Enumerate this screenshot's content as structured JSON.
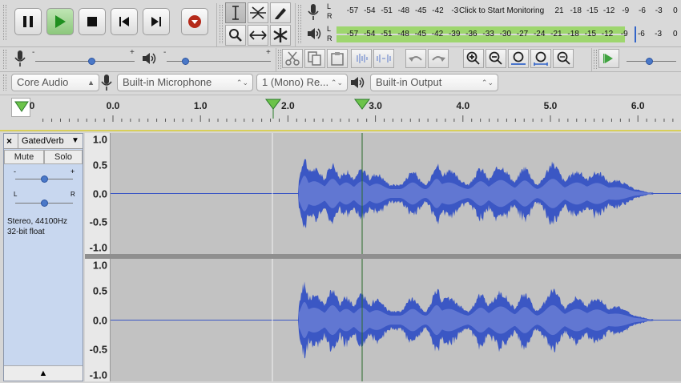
{
  "transport": {
    "buttons": [
      {
        "name": "pause",
        "label": "Pause"
      },
      {
        "name": "play",
        "label": "Play"
      },
      {
        "name": "stop",
        "label": "Stop"
      },
      {
        "name": "skip-to-start",
        "label": "Skip to Start"
      },
      {
        "name": "skip-to-end",
        "label": "Skip to End"
      },
      {
        "name": "record",
        "label": "Record"
      }
    ]
  },
  "tools": [
    "selection-tool",
    "envelope-tool",
    "draw-tool",
    "zoom-tool",
    "time-shift-tool",
    "multi-tool"
  ],
  "meters": {
    "record_scale": [
      "-57",
      "-54",
      "-51",
      "-48",
      "-45",
      "-42",
      "-3"
    ],
    "record_prompt": "Click to Start Monitoring",
    "record_scale_right": [
      "21",
      "-18",
      "-15",
      "-12",
      "-9",
      "-6",
      "-3",
      "0"
    ],
    "play_scale": [
      "-57",
      "-54",
      "-51",
      "-48",
      "-45",
      "-42",
      "-39",
      "-36",
      "-33",
      "-30",
      "-27",
      "-24",
      "-21",
      "-18",
      "-15",
      "-12",
      "-9",
      "-6",
      "-3",
      "0"
    ],
    "l_label": "L",
    "r_label": "R",
    "play_level_fraction": 0.83
  },
  "mixer": {
    "record_volume_fraction": 0.42,
    "playback_volume_fraction": 0.18,
    "slider_minus": "-",
    "slider_plus": "+"
  },
  "devices": {
    "host": "Core Audio",
    "recording_device": "Built-in Microphone",
    "channels": "1 (Mono) Re...",
    "playback_device": "Built-in Output"
  },
  "timeline": {
    "labels": [
      "0",
      "0.0",
      "1.0",
      "2.0",
      "3.0",
      "4.0",
      "5.0",
      "6.0"
    ],
    "cursor_seconds": 2.0,
    "play_head_seconds": 3.02
  },
  "track": {
    "name": "GatedVerb",
    "close_label": "×",
    "menu_arrow": "▼",
    "mute_label": "Mute",
    "solo_label": "Solo",
    "gain_minus": "-",
    "gain_plus": "+",
    "pan_left": "L",
    "pan_right": "R",
    "info_line1": "Stereo, 44100Hz",
    "info_line2": "32-bit float",
    "collapse_arrow": "▲",
    "scale_labels": [
      "1.0",
      "0.5",
      "0.0",
      "-0.5",
      "-1.0"
    ]
  },
  "colors": {
    "waveform": "#3b57c4",
    "waveform_light": "#6b7fd6",
    "track_bg": "#c2c2c2",
    "meter_green": "#9ed66e",
    "record_red": "#b52a1a"
  }
}
